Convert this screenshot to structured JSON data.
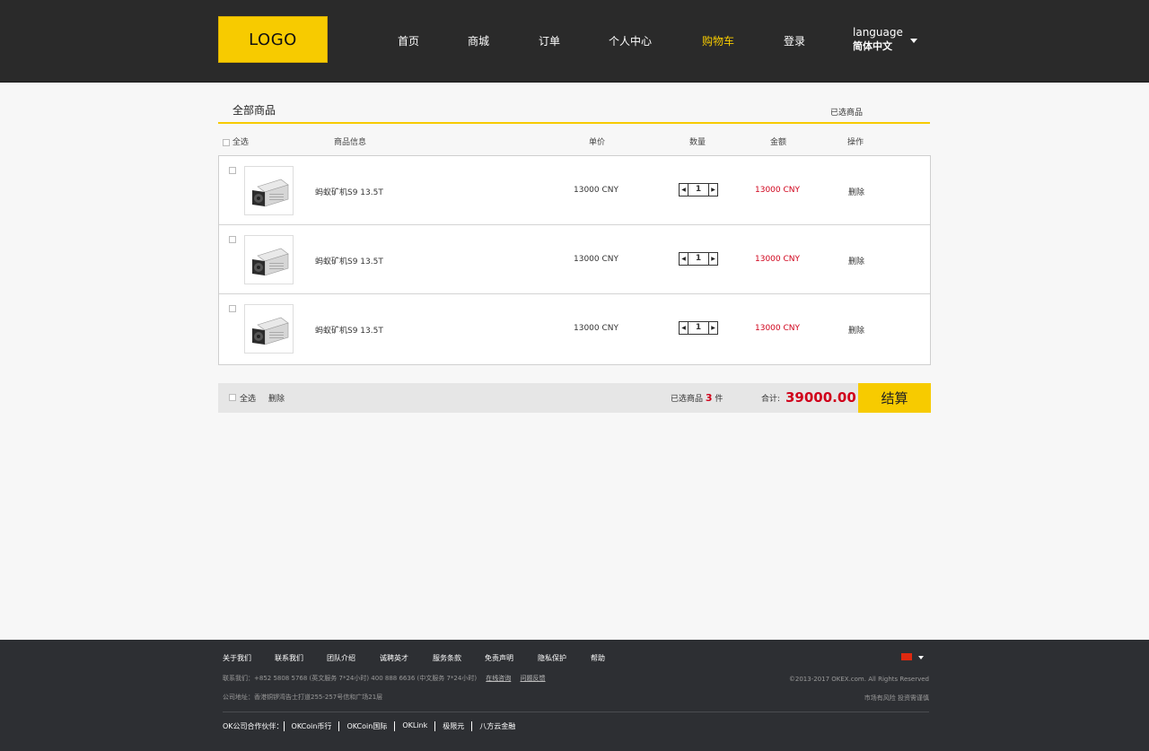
{
  "header": {
    "logo": "LOGO",
    "nav": [
      "首页",
      "商城",
      "订单",
      "个人中心",
      "购物车",
      "登录"
    ],
    "active_nav": "购物车",
    "language_label": "language",
    "language_value": "简体中文"
  },
  "cart": {
    "tab_all": "全部商品",
    "tab_selected": "已选商品",
    "columns": {
      "select_all": "全选",
      "info": "商品信息",
      "unit_price": "单价",
      "quantity": "数量",
      "amount": "金额",
      "action": "操作"
    },
    "items": [
      {
        "name": "蚂蚁矿机S9 13.5T",
        "price": "13000 CNY",
        "qty": "1",
        "amount": "13000 CNY",
        "delete": "删除"
      },
      {
        "name": "蚂蚁矿机S9 13.5T",
        "price": "13000 CNY",
        "qty": "1",
        "amount": "13000 CNY",
        "delete": "删除"
      },
      {
        "name": "蚂蚁矿机S9 13.5T",
        "price": "13000 CNY",
        "qty": "1",
        "amount": "13000 CNY",
        "delete": "删除"
      }
    ]
  },
  "summary": {
    "select_all": "全选",
    "delete": "删除",
    "selected_prefix": "已选商品",
    "selected_count": "3",
    "selected_suffix": "件",
    "total_label": "合计:",
    "total_value": "39000.00",
    "checkout": "结算"
  },
  "footer": {
    "links": [
      "关于我们",
      "联系我们",
      "团队介绍",
      "诚聘英才",
      "服务条款",
      "免责声明",
      "隐私保护",
      "帮助"
    ],
    "contact": "联系我们：+852 5808 5768 (英文服务 7*24小时)    400 888 6636 (中文服务 7*24小时)",
    "contact_link1": "在线咨询",
    "contact_link2": "问题反馈",
    "address": "公司地址：香港铜锣湾告士打道255-257号信和广场21层",
    "copyright": "©2013-2017 OKEX.com. All Rights Reserved",
    "risk": "市场有风险 投资需谨慎",
    "partners_label": "OK公司合作伙伴：",
    "partners": [
      "OKCoin币行",
      "OKCoin国际",
      "OKLink",
      "极限元",
      "八方云金融"
    ]
  },
  "colors": {
    "accent": "#f7cb00",
    "price_red": "#d0021b",
    "header_bg": "#2a2a2a",
    "footer_bg": "#2d2f33"
  }
}
